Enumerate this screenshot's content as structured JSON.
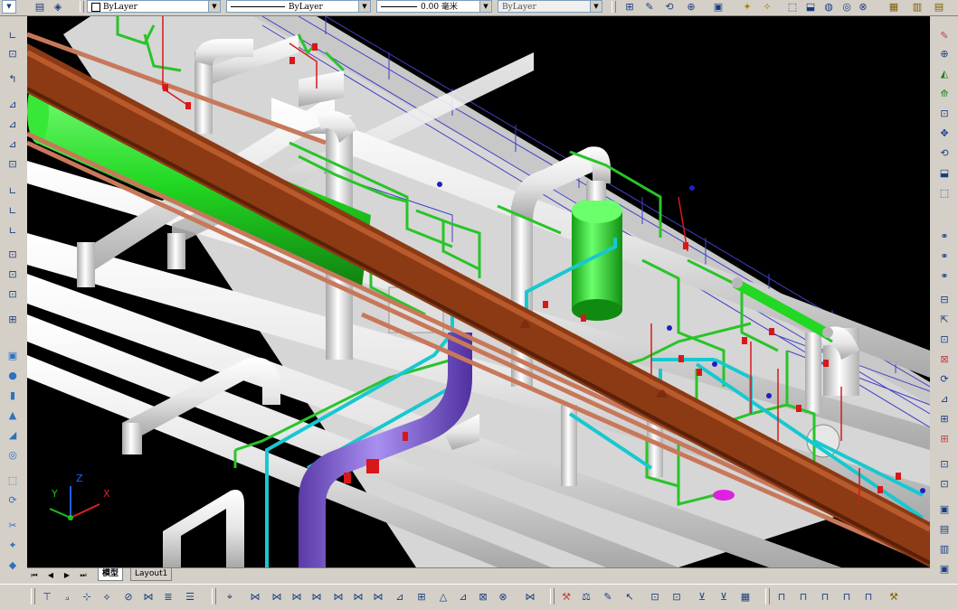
{
  "toolbar_top": {
    "color_dropdown": "ByLayer",
    "linetype_dropdown": "ByLayer",
    "lineweight_dropdown": "0.00 毫米",
    "plotstyle_dropdown": "ByLayer"
  },
  "layout_tabs": {
    "model": "模型",
    "layout1": "Layout1"
  },
  "ucs_axes": {
    "x": "X",
    "y": "Y",
    "z": "Z"
  },
  "colors": {
    "background": "#000000",
    "main_pipe": "#8b3a14",
    "copper_pipe": "#c8785a",
    "vessel": "#22d822",
    "green_line": "#28c428",
    "cyan_line": "#18c8d0",
    "magenta_pipe": "#e020e0",
    "purple_pipe": "#7856c8",
    "white_pipe": "#e6e6e6",
    "floor_slab": "#d8d8d8",
    "rail": "#4040c8",
    "red_valve": "#d81818"
  }
}
